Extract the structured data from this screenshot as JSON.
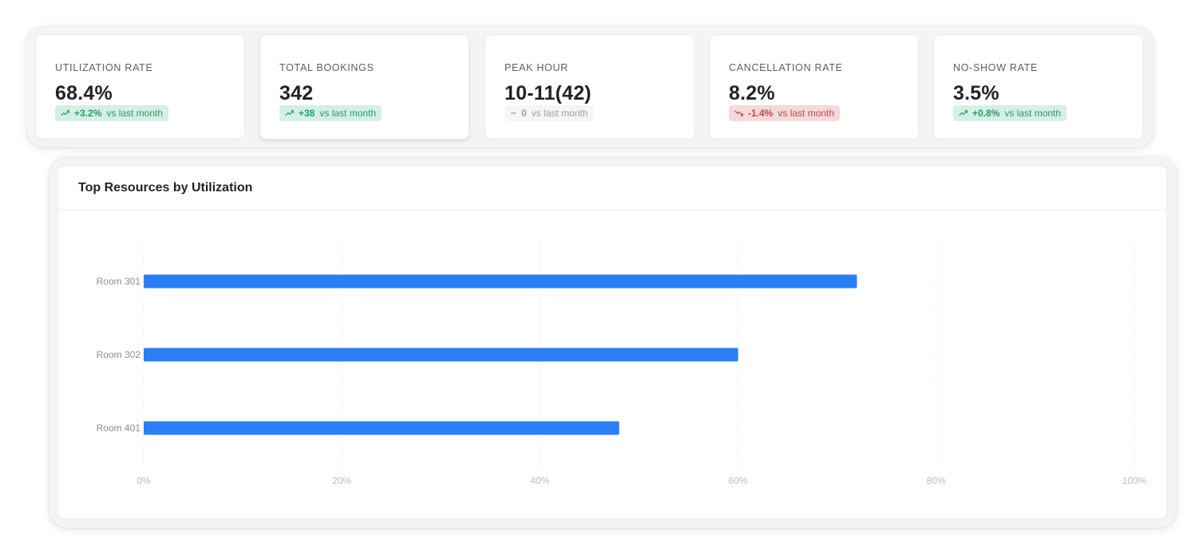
{
  "kpis": [
    {
      "label": "UTILIZATION RATE",
      "value": "68.4%",
      "delta": "+3.2%",
      "delta_text": "vs last month",
      "trend": "up"
    },
    {
      "label": "TOTAL BOOKINGS",
      "value": "342",
      "delta": "+38",
      "delta_text": "vs last month",
      "trend": "up"
    },
    {
      "label": "PEAK HOUR",
      "value": "10-11(42)",
      "delta": "0",
      "delta_text": "vs last month",
      "trend": "flat"
    },
    {
      "label": "CANCELLATION RATE",
      "value": "8.2%",
      "delta": "-1.4%",
      "delta_text": "vs last month",
      "trend": "down"
    },
    {
      "label": "NO-SHOW RATE",
      "value": "3.5%",
      "delta": "+0.8%",
      "delta_text": "vs last month",
      "trend": "up"
    }
  ],
  "colors": {
    "bar": "#2b7ff6",
    "up": "#23a06b",
    "down": "#c24848",
    "flat": "#9aa0a6"
  },
  "chart_panel": {
    "title": "Top Resources by Utilization"
  },
  "chart_data": {
    "type": "bar",
    "orientation": "horizontal",
    "title": "Top Resources by Utilization",
    "categories": [
      "Room 301",
      "Room 302",
      "Room 401"
    ],
    "values": [
      72,
      60,
      48
    ],
    "xlim": [
      0,
      100
    ],
    "xticks": [
      "0%",
      "20%",
      "40%",
      "60%",
      "80%",
      "100%"
    ],
    "xtick_values": [
      0,
      20,
      40,
      60,
      80,
      100
    ],
    "grid": "vertical dashed",
    "legend": "none"
  }
}
